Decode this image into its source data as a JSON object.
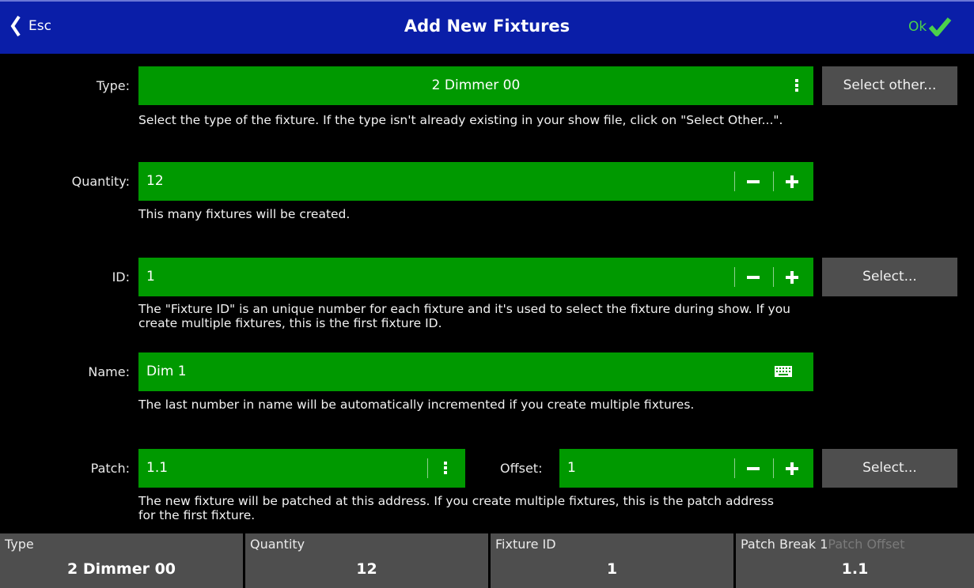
{
  "header": {
    "esc_label": "Esc",
    "title": "Add New Fixtures",
    "ok_label": "Ok"
  },
  "type": {
    "label": "Type:",
    "value": "2 Dimmer 00",
    "select_button": "Select other...",
    "description": "Select the type of the fixture. If the type isn't already existing in your show file, click on \"Select Other...\"."
  },
  "quantity": {
    "label": "Quantity:",
    "value": "12",
    "description": "This many fixtures will be created."
  },
  "id": {
    "label": "ID:",
    "value": "1",
    "select_button": "Select...",
    "description_line1": "The \"Fixture ID\" is an unique number for each fixture and it's used to select the fixture during show. If you",
    "description_line2": "create multiple fixtures, this is the first fixture ID."
  },
  "name": {
    "label": "Name:",
    "value": "Dim 1",
    "description": "The last number in name will be automatically incremented if you create multiple fixtures."
  },
  "patch": {
    "label": "Patch:",
    "value": "1.1",
    "offset_label": "Offset:",
    "offset_value": "1",
    "select_button": "Select...",
    "description_line1": "The new fixture will be patched at this address. If you create multiple fixtures, this is the patch address",
    "description_line2": "for the first fixture."
  },
  "summary": {
    "type_caption": "Type",
    "type_value": "2 Dimmer 00",
    "quantity_caption": "Quantity",
    "quantity_value": "12",
    "fixture_id_caption": "Fixture ID",
    "fixture_id_value": "1",
    "patch_break_caption": "Patch Break 1",
    "patch_offset_caption": "Patch Offset",
    "patch_value": "1.1"
  },
  "colors": {
    "header_blue": "#0a1ea8",
    "field_green": "#009900",
    "button_grey": "#4e4e4e",
    "ok_green": "#4bd14b"
  },
  "icons": [
    "chevron-left-icon",
    "checkmark-icon",
    "more-vertical-icon",
    "minus-icon",
    "plus-icon",
    "keyboard-icon"
  ]
}
